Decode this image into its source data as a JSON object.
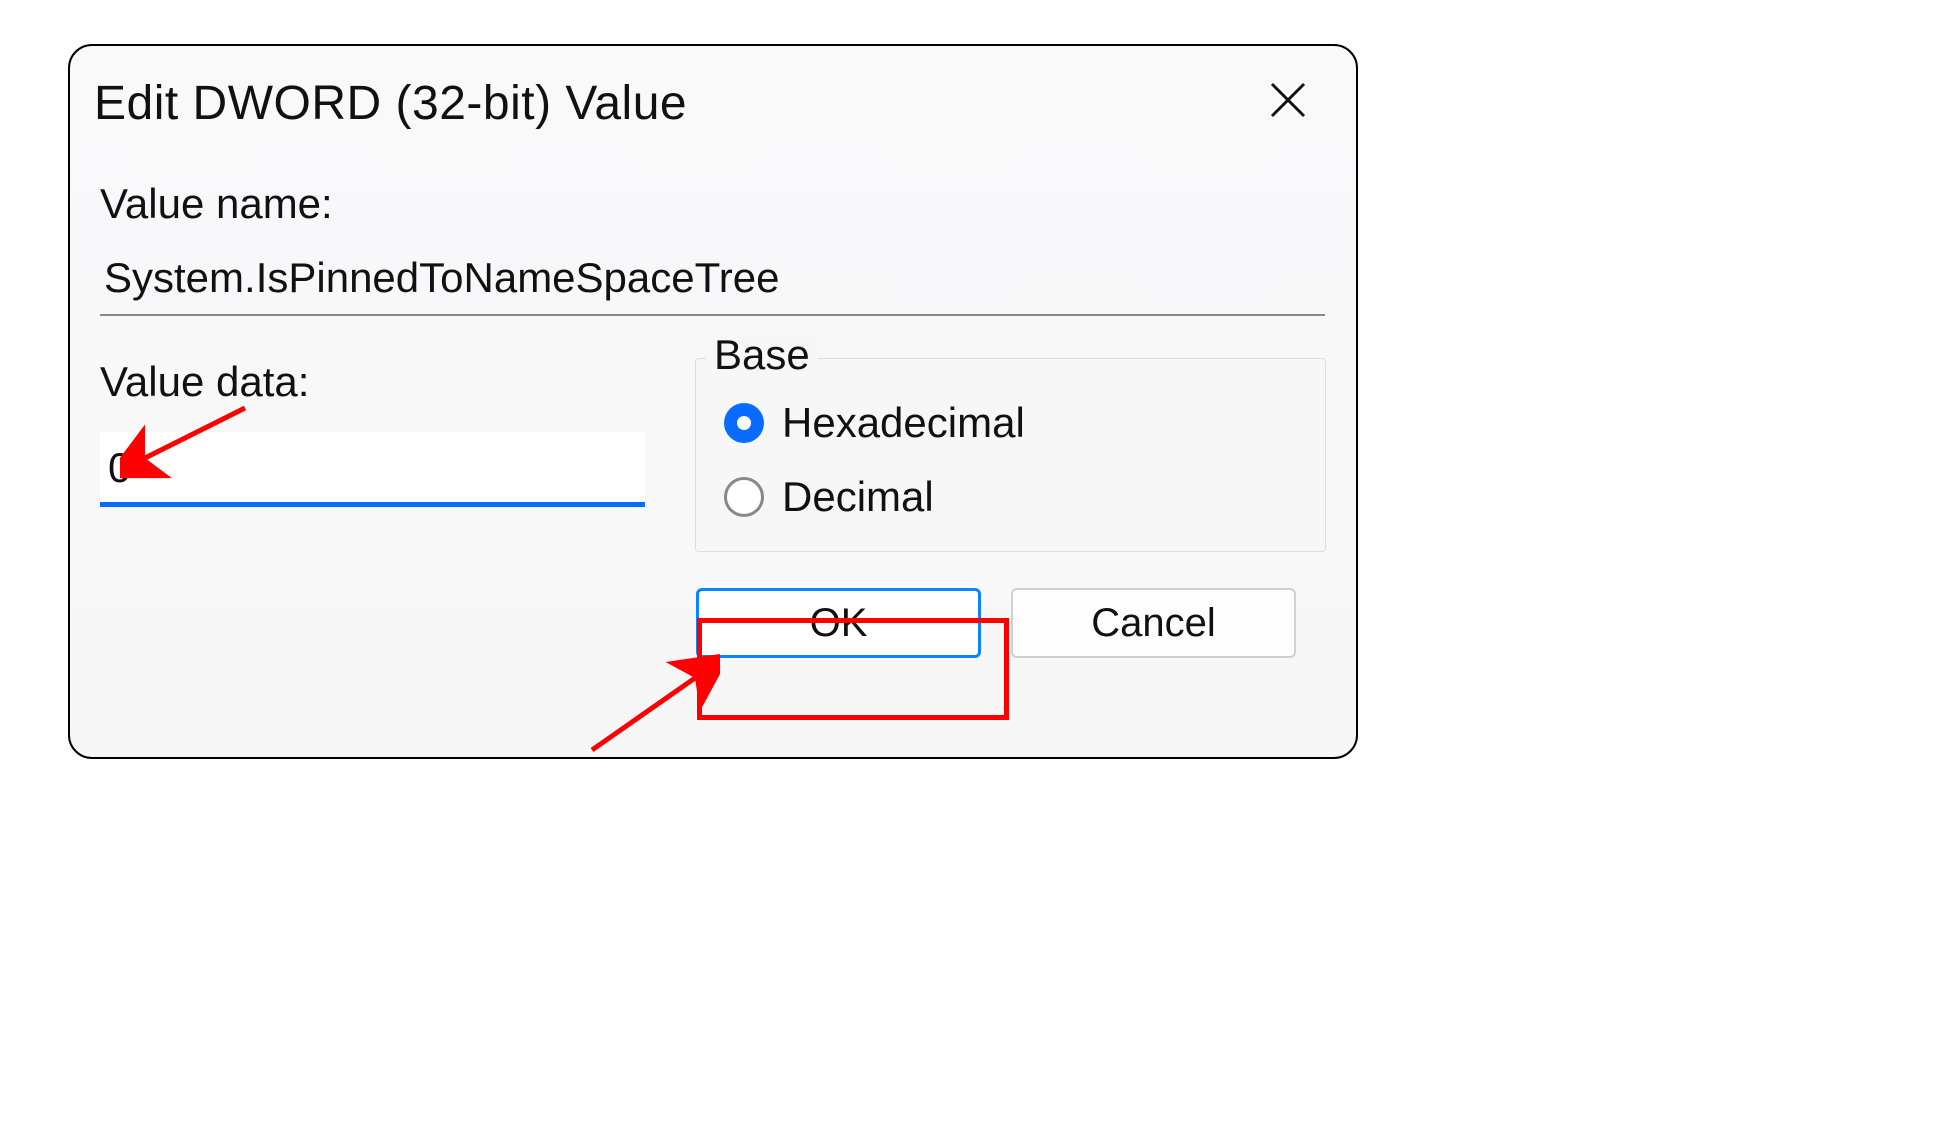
{
  "dialog": {
    "title": "Edit DWORD (32-bit) Value",
    "labels": {
      "value_name": "Value name:",
      "value_data": "Value data:",
      "base": "Base"
    },
    "fields": {
      "value_name": "System.IsPinnedToNameSpaceTree",
      "value_data": "0"
    },
    "base_options": {
      "hex": "Hexadecimal",
      "dec": "Decimal",
      "selected": "hex"
    },
    "buttons": {
      "ok": "OK",
      "cancel": "Cancel"
    }
  },
  "colors": {
    "accent": "#0a6cff",
    "highlight": "#ff0000"
  }
}
